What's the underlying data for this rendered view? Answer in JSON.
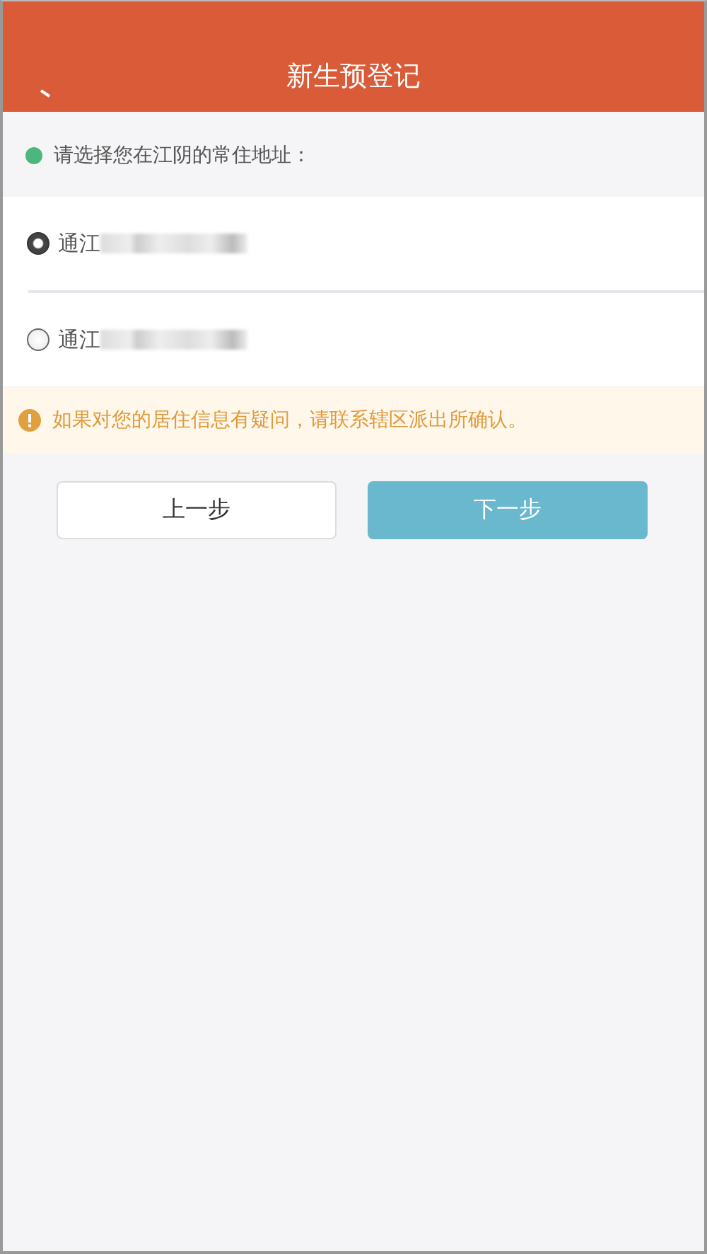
{
  "header": {
    "title": "新生预登记"
  },
  "prompt": {
    "text": "请选择您在江阴的常住地址："
  },
  "options": [
    {
      "label": "通江",
      "selected": true
    },
    {
      "label": "通江",
      "selected": false
    }
  ],
  "notice": {
    "text": "如果对您的居住信息有疑问，请联系辖区派出所确认。"
  },
  "buttons": [
    {
      "label": "上一步",
      "kind": "secondary"
    },
    {
      "label": "下一步",
      "kind": "primary"
    }
  ]
}
